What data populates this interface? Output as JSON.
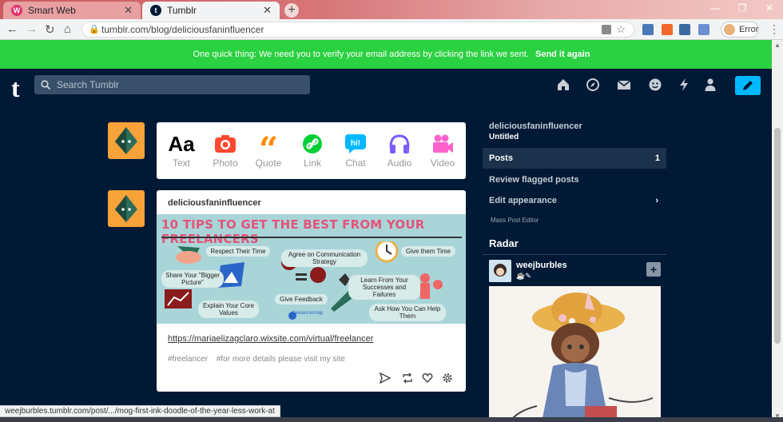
{
  "browser": {
    "tabs": [
      {
        "title": "Smart Web",
        "active": false
      },
      {
        "title": "Tumblr",
        "active": true
      }
    ],
    "new_tab": "+",
    "url": "tumblr.com/blog/deliciousfaninfluencer",
    "profile_status": "Error",
    "status_url": "weejburbles.tumblr.com/post/.../mog-first-ink-doodle-of-the-year-less-work-at"
  },
  "banner": {
    "message": "One quick thing:  We need you to verify your email address by clicking the link we sent.",
    "link": "Send it again"
  },
  "header": {
    "logo": "t",
    "search_placeholder": "Search Tumblr",
    "nav_icons": [
      "home-icon",
      "explore-icon",
      "inbox-icon",
      "messaging-icon",
      "activity-icon",
      "account-icon"
    ],
    "accent": "#00b8ff"
  },
  "post_types": [
    {
      "label": "Text",
      "color": "#000000"
    },
    {
      "label": "Photo",
      "color": "#ff4930"
    },
    {
      "label": "Quote",
      "color": "#ff8a00"
    },
    {
      "label": "Link",
      "color": "#00cf35"
    },
    {
      "label": "Chat",
      "color": "#00b8ff"
    },
    {
      "label": "Audio",
      "color": "#7c5cff"
    },
    {
      "label": "Video",
      "color": "#ff62ce"
    }
  ],
  "post": {
    "blog_name": "deliciousfaninfluencer",
    "infographic": {
      "title": "10 TIPS TO GET THE BEST FROM YOUR FREELANCERS",
      "tips": [
        "Respect Their Time",
        "Agree on Communication Strategy",
        "Give them Time",
        "Share Your \"Bigger Picture\"",
        "Learn From Your Successes and Failures",
        "Give Feedback",
        "Explain Your Core Values",
        "Ask How You Can Help Them"
      ],
      "brand": "freelancermap"
    },
    "link": "https://mariaelizagclaro.wixsite.com/virtual/freelancer",
    "tags": [
      "#freelancer",
      "#for more details please visit my site"
    ]
  },
  "sidebar": {
    "blog_name": "deliciousfaninfluencer",
    "blog_title": "Untitled",
    "items": [
      {
        "label": "Posts",
        "count": "1"
      },
      {
        "label": "Review flagged posts"
      },
      {
        "label": "Edit appearance",
        "chevron": "›"
      }
    ],
    "mass_post_editor": "Mass Post Editor",
    "radar": {
      "heading": "Radar",
      "user": "weejburbles",
      "sub": "☕✎",
      "follow": "+"
    }
  }
}
